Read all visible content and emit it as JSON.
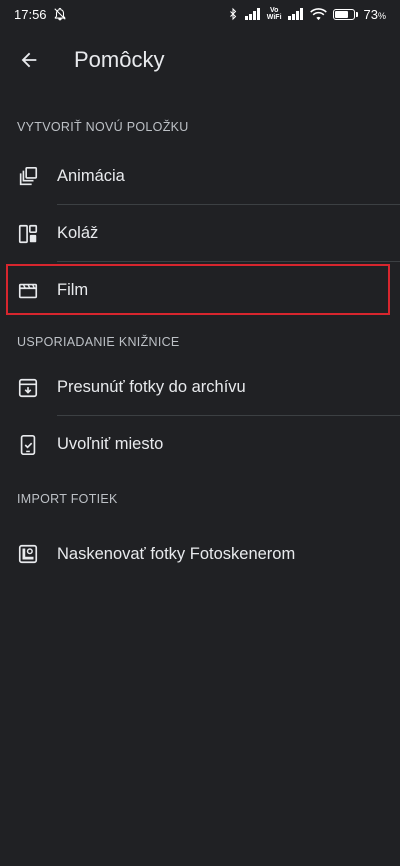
{
  "status_bar": {
    "time": "17:56",
    "volte_top": "Vo",
    "volte_bottom": "WiFi",
    "battery_percent": "73",
    "battery_suffix": "%",
    "battery_level": 0.73
  },
  "header": {
    "back_icon": "arrow-back-icon",
    "title": "Pomôcky"
  },
  "sections": [
    {
      "title": "VYTVORIŤ NOVÚ POLOŽKU",
      "items": [
        {
          "label": "Animácia",
          "icon": "animation-icon"
        },
        {
          "label": "Koláž",
          "icon": "collage-icon"
        },
        {
          "label": "Film",
          "icon": "movie-icon"
        }
      ]
    },
    {
      "title": "USPORIADANIE KNIŽNICE",
      "items": [
        {
          "label": "Presunúť fotky do archívu",
          "icon": "archive-icon"
        },
        {
          "label": "Uvoľniť miesto",
          "icon": "free-space-icon"
        }
      ]
    },
    {
      "title": "IMPORT FOTIEK",
      "items": [
        {
          "label": "Naskenovať fotky Fotoskenerom",
          "icon": "photoscan-icon"
        }
      ]
    }
  ],
  "colors": {
    "background": "#202124",
    "text": "#e8eaed",
    "section_text": "#bdc1c6",
    "divider": "#3c4043",
    "highlight": "#d7262e"
  }
}
